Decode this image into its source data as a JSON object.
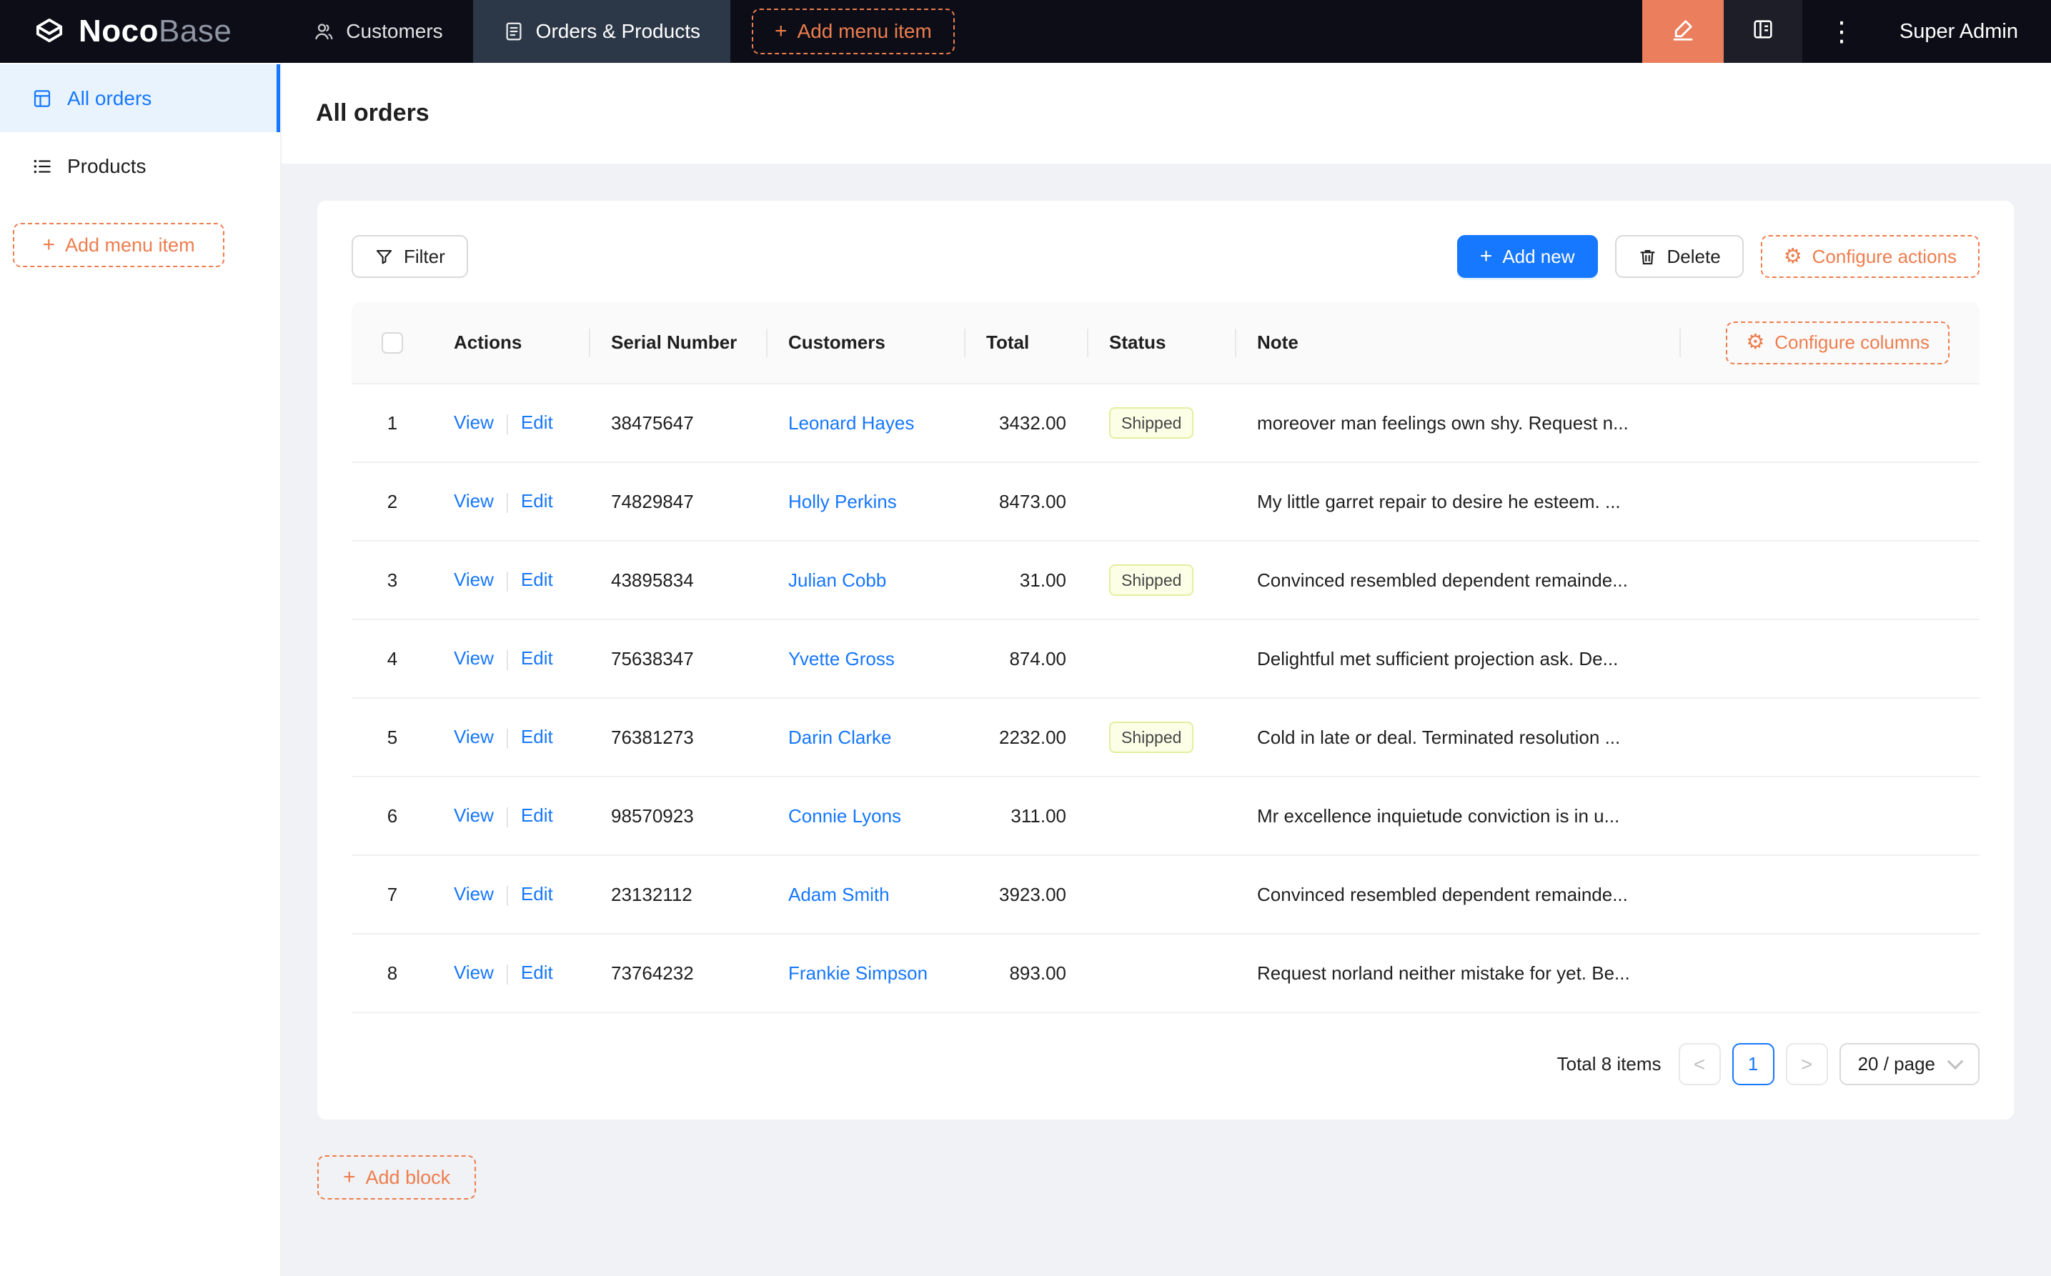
{
  "colors": {
    "primary": "#1677ff",
    "accent": "#ed7d4e",
    "designer-bg": "#ea7e5d",
    "header-bg": "#0c0d17",
    "header-active": "#2c3847",
    "sidebar-active-bg": "#e8f3fe",
    "tag-bg": "#fcffe6",
    "tag-border": "#e3ee9e",
    "content-bg": "#f0f2f5"
  },
  "icons": {
    "plus": "+",
    "dots": "⋮",
    "gear": "⚙",
    "prev": "<",
    "next": ">"
  },
  "header": {
    "logo_primary": "Noco",
    "logo_secondary": "Base",
    "nav": {
      "customers": "Customers",
      "orders_products": "Orders & Products"
    },
    "add_menu_item": "Add menu item",
    "user": "Super Admin"
  },
  "sidebar": {
    "items": [
      {
        "label": "All orders",
        "active": true
      },
      {
        "label": "Products",
        "active": false
      }
    ],
    "add_menu_item": "Add menu item"
  },
  "page": {
    "title": "All orders"
  },
  "toolbar": {
    "filter": "Filter",
    "add_new": "Add new",
    "delete": "Delete",
    "configure_actions": "Configure actions"
  },
  "table": {
    "columns": [
      "Actions",
      "Serial Number",
      "Customers",
      "Total",
      "Status",
      "Note"
    ],
    "configure_columns": "Configure columns",
    "labels": {
      "view": "View",
      "edit": "Edit"
    },
    "rows": [
      {
        "index": 1,
        "serial": "38475647",
        "customer": "Leonard Hayes",
        "total": "3432.00",
        "status": "Shipped",
        "note": "moreover man feelings own shy. Request n..."
      },
      {
        "index": 2,
        "serial": "74829847",
        "customer": "Holly Perkins",
        "total": "8473.00",
        "status": "",
        "note": "My little garret repair to desire he esteem. ..."
      },
      {
        "index": 3,
        "serial": "43895834",
        "customer": "Julian Cobb",
        "total": "31.00",
        "status": "Shipped",
        "note": "Convinced resembled dependent remainde..."
      },
      {
        "index": 4,
        "serial": "75638347",
        "customer": "Yvette Gross",
        "total": "874.00",
        "status": "",
        "note": "Delightful met sufficient projection ask. De..."
      },
      {
        "index": 5,
        "serial": "76381273",
        "customer": "Darin Clarke",
        "total": "2232.00",
        "status": "Shipped",
        "note": "Cold in late or deal. Terminated resolution ..."
      },
      {
        "index": 6,
        "serial": "98570923",
        "customer": "Connie Lyons",
        "total": "311.00",
        "status": "",
        "note": "Mr excellence inquietude conviction is in u..."
      },
      {
        "index": 7,
        "serial": "23132112",
        "customer": "Adam Smith",
        "total": "3923.00",
        "status": "",
        "note": "Convinced resembled dependent remainde..."
      },
      {
        "index": 8,
        "serial": "73764232",
        "customer": "Frankie Simpson",
        "total": "893.00",
        "status": "",
        "note": "Request norland neither mistake for yet. Be..."
      }
    ]
  },
  "pagination": {
    "total": "Total 8 items",
    "page": "1",
    "size": "20 / page"
  },
  "add_block": "Add block"
}
